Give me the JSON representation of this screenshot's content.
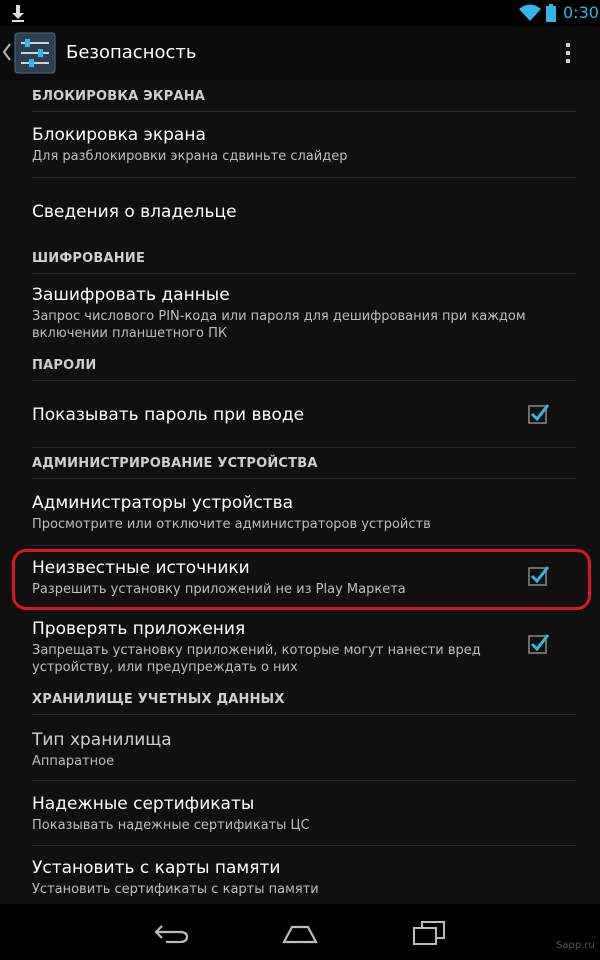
{
  "status_bar": {
    "time": "0:30",
    "icons": [
      "download-icon",
      "wifi-icon",
      "battery-icon"
    ],
    "accent_color": "#33b5e5"
  },
  "action_bar": {
    "title": "Безопасность",
    "icons": [
      "back-chevron-icon",
      "settings-sliders-icon",
      "overflow-menu-icon"
    ]
  },
  "sections": {
    "screen_lock": {
      "header": "БЛОКИРОВКА ЭКРАНА",
      "items": [
        {
          "title": "Блокировка экрана",
          "summary": "Для разблокировки экрана сдвиньте слайдер"
        },
        {
          "title": "Сведения о владельце"
        }
      ]
    },
    "encryption": {
      "header": "ШИФРОВАНИЕ",
      "items": [
        {
          "title": "Зашифровать данные",
          "summary_line1": "Запрос числового PIN-кода или пароля для дешифрования при каждом",
          "summary_line2": "включении планшетного ПК"
        }
      ]
    },
    "passwords": {
      "header": "ПАРОЛИ",
      "items": [
        {
          "title": "Показывать пароль при вводе",
          "checked": true
        }
      ]
    },
    "device_admin": {
      "header": "АДМИНИСТРИРОВАНИЕ УСТРОЙСТВА",
      "items": [
        {
          "title": "Администраторы устройства",
          "summary": "Просмотрите или отключите администраторов устройств"
        },
        {
          "title": "Неизвестные источники",
          "summary": "Разрешить установку приложений не из Play Маркета",
          "checked": true
        },
        {
          "title": "Проверять приложения",
          "summary_line1": "Запрещать установку приложений, которые могут нанести вред",
          "summary_line2": "устройству, или предупреждать о них",
          "checked": true
        }
      ]
    },
    "credential_storage": {
      "header": "ХРАНИЛИЩЕ УЧЕТНЫХ ДАННЫХ",
      "items": [
        {
          "title": "Тип хранилища",
          "summary": "Аппаратное"
        },
        {
          "title": "Надежные сертификаты",
          "summary": "Показывать надежные сертификаты ЦС"
        },
        {
          "title": "Установить с карты памяти",
          "summary": "Установить сертификаты с карты памяти"
        }
      ]
    }
  },
  "highlight_color": "#e0141e",
  "checkbox_color": "#33b5e5",
  "nav_bar": {
    "icons": [
      "back-icon",
      "home-icon",
      "recent-apps-icon"
    ],
    "watermark": "Sapp.ru"
  }
}
